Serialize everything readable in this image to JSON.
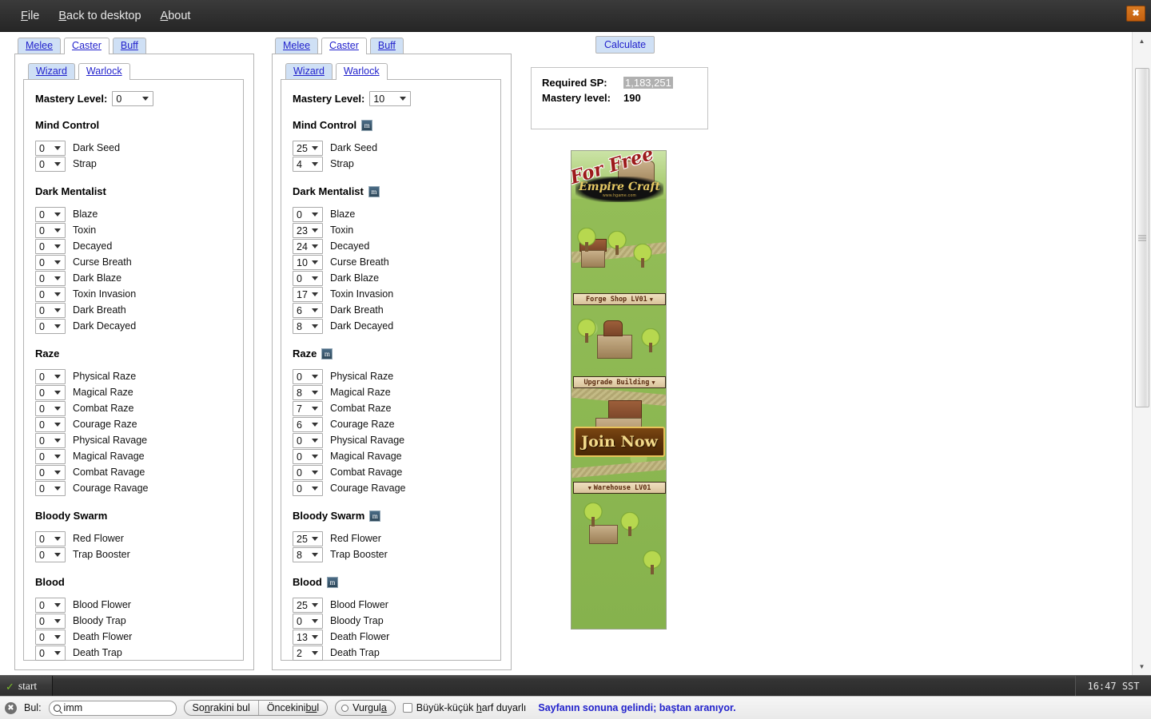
{
  "window": {
    "close_label": "✖",
    "menu": [
      {
        "label": "File",
        "accel": "F"
      },
      {
        "label": "Back to desktop",
        "accel": "B"
      },
      {
        "label": "About",
        "accel": "A"
      }
    ]
  },
  "panels": [
    {
      "id": "left",
      "outer_tabs": [
        {
          "label": "Melee",
          "active": false
        },
        {
          "label": "Caster",
          "active": true
        },
        {
          "label": "Buff",
          "active": false
        }
      ],
      "inner_tabs": [
        {
          "label": "Wizard",
          "active": false
        },
        {
          "label": "Warlock",
          "active": true
        }
      ],
      "mastery_label": "Mastery Level:",
      "mastery_value": "0",
      "groups": [
        {
          "title": "Mind Control",
          "badge": "",
          "skills": [
            {
              "value": "0",
              "label": "Dark Seed"
            },
            {
              "value": "0",
              "label": "Strap"
            }
          ]
        },
        {
          "title": "Dark Mentalist",
          "badge": "",
          "skills": [
            {
              "value": "0",
              "label": "Blaze"
            },
            {
              "value": "0",
              "label": "Toxin"
            },
            {
              "value": "0",
              "label": "Decayed"
            },
            {
              "value": "0",
              "label": "Curse Breath"
            },
            {
              "value": "0",
              "label": "Dark Blaze"
            },
            {
              "value": "0",
              "label": "Toxin Invasion"
            },
            {
              "value": "0",
              "label": "Dark Breath"
            },
            {
              "value": "0",
              "label": "Dark Decayed"
            }
          ]
        },
        {
          "title": "Raze",
          "badge": "",
          "skills": [
            {
              "value": "0",
              "label": "Physical Raze"
            },
            {
              "value": "0",
              "label": "Magical Raze"
            },
            {
              "value": "0",
              "label": "Combat Raze"
            },
            {
              "value": "0",
              "label": "Courage Raze"
            },
            {
              "value": "0",
              "label": "Physical Ravage"
            },
            {
              "value": "0",
              "label": "Magical Ravage"
            },
            {
              "value": "0",
              "label": "Combat Ravage"
            },
            {
              "value": "0",
              "label": "Courage Ravage"
            }
          ]
        },
        {
          "title": "Bloody Swarm",
          "badge": "",
          "skills": [
            {
              "value": "0",
              "label": "Red Flower"
            },
            {
              "value": "0",
              "label": "Trap Booster"
            }
          ]
        },
        {
          "title": "Blood",
          "badge": "",
          "skills": [
            {
              "value": "0",
              "label": "Blood Flower"
            },
            {
              "value": "0",
              "label": "Bloody Trap"
            },
            {
              "value": "0",
              "label": "Death Flower"
            },
            {
              "value": "0",
              "label": "Death Trap"
            }
          ]
        }
      ]
    },
    {
      "id": "right",
      "outer_tabs": [
        {
          "label": "Melee",
          "active": false
        },
        {
          "label": "Caster",
          "active": true
        },
        {
          "label": "Buff",
          "active": false
        }
      ],
      "inner_tabs": [
        {
          "label": "Wizard",
          "active": false
        },
        {
          "label": "Warlock",
          "active": true
        }
      ],
      "mastery_label": "Mastery Level:",
      "mastery_value": "10",
      "groups": [
        {
          "title": "Mind Control",
          "badge": "m",
          "skills": [
            {
              "value": "25",
              "label": "Dark Seed"
            },
            {
              "value": "4",
              "label": "Strap"
            }
          ]
        },
        {
          "title": "Dark Mentalist",
          "badge": "m",
          "skills": [
            {
              "value": "0",
              "label": "Blaze"
            },
            {
              "value": "23",
              "label": "Toxin"
            },
            {
              "value": "24",
              "label": "Decayed"
            },
            {
              "value": "10",
              "label": "Curse Breath"
            },
            {
              "value": "0",
              "label": "Dark Blaze"
            },
            {
              "value": "17",
              "label": "Toxin Invasion"
            },
            {
              "value": "6",
              "label": "Dark Breath"
            },
            {
              "value": "8",
              "label": "Dark Decayed"
            }
          ]
        },
        {
          "title": "Raze",
          "badge": "m",
          "skills": [
            {
              "value": "0",
              "label": "Physical Raze"
            },
            {
              "value": "8",
              "label": "Magical Raze"
            },
            {
              "value": "7",
              "label": "Combat Raze"
            },
            {
              "value": "6",
              "label": "Courage Raze"
            },
            {
              "value": "0",
              "label": "Physical Ravage"
            },
            {
              "value": "0",
              "label": "Magical Ravage"
            },
            {
              "value": "0",
              "label": "Combat Ravage"
            },
            {
              "value": "0",
              "label": "Courage Ravage"
            }
          ]
        },
        {
          "title": "Bloody Swarm",
          "badge": "m",
          "skills": [
            {
              "value": "25",
              "label": "Red Flower"
            },
            {
              "value": "8",
              "label": "Trap Booster"
            }
          ]
        },
        {
          "title": "Blood",
          "badge": "m",
          "skills": [
            {
              "value": "25",
              "label": "Blood Flower"
            },
            {
              "value": "0",
              "label": "Bloody Trap"
            },
            {
              "value": "13",
              "label": "Death Flower"
            },
            {
              "value": "2",
              "label": "Death Trap"
            }
          ]
        }
      ]
    }
  ],
  "result": {
    "calculate_label": "Calculate",
    "required_sp_label": "Required SP:",
    "required_sp_value": "1,183,251",
    "mastery_level_label": "Mastery level:",
    "mastery_level_value": "190"
  },
  "ad": {
    "for_free": "For Free",
    "logo_title": "Empire Craft",
    "logo_url": "www.hgame.com",
    "label_forge": "Forge Shop   LV01",
    "label_upgrade": "Upgrade Building",
    "label_warehouse": "Warehouse  LV01",
    "join_now": "Join Now",
    "caret": "▼"
  },
  "taskbar": {
    "start_label": "start",
    "start_icon": "leaf-icon",
    "clock": "16:47 SST"
  },
  "findbar": {
    "close_icon": "✖",
    "label": "Bul:",
    "input_value": "imm",
    "next_button": "Sonrakini bul",
    "next_accel": "n",
    "prev_button": "Öncekini bul",
    "prev_accel": "bu",
    "highlight_button": "Vurgula",
    "highlight_accel": "a",
    "match_case": "Büyük-küçük harf duyarlı",
    "match_case_accel": "h",
    "status": "Sayfanın sonuna gelindi; baştan aranıyor."
  }
}
